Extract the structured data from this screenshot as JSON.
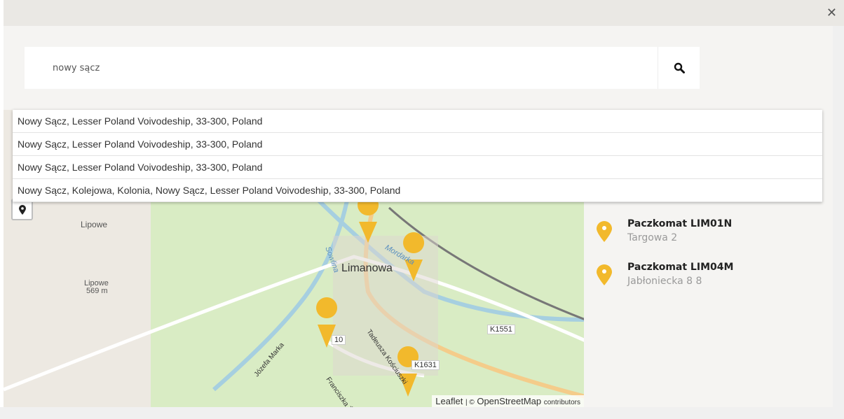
{
  "search": {
    "value": "nowy sącz"
  },
  "suggestions": [
    "Nowy Sącz, Lesser Poland Voivodeship, 33-300, Poland",
    "Nowy Sącz, Lesser Poland Voivodeship, 33-300, Poland",
    "Nowy Sącz, Lesser Poland Voivodeship, 33-300, Poland",
    "Nowy Sącz, Kolejowa, Kolonia, Nowy Sącz, Lesser Poland Voivodeship, 33-300, Poland"
  ],
  "lockers": [
    {
      "name": "Paczkomat LIM01N",
      "address": "Targowa 2"
    },
    {
      "name": "Paczkomat LIM04M",
      "address": "Jabłoniecka 8 8"
    }
  ],
  "map": {
    "labels": {
      "town": "Limanowa",
      "village": "Lipowe",
      "peak": "Lipowe",
      "peak_height": "569 m",
      "road1": "K1551",
      "road2": "K1631",
      "road3": "10",
      "street1": "Tadeusza Kościuszki",
      "street2": "Józefa Marka",
      "street3": "Franciszka Żwir",
      "river1": "Sowlina",
      "river2": "Mordarka"
    },
    "attribution": {
      "leaflet": "Leaflet",
      "sep": "| ©",
      "osm": "OpenStreetMap",
      "contrib": "contributors"
    }
  },
  "colors": {
    "marker": "#f2b92c",
    "accent": "#f9c92f"
  }
}
